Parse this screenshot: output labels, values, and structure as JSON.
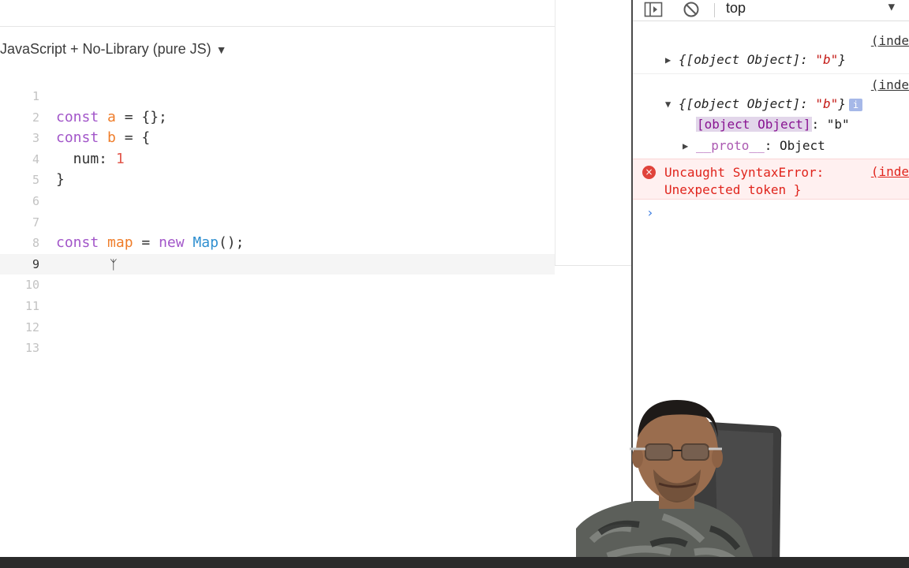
{
  "editor": {
    "language_selector": "JavaScript + No-Library (pure JS)",
    "active_line": 9,
    "lines": [
      {
        "n": "1",
        "tokens": []
      },
      {
        "n": "2",
        "tokens": [
          [
            "kw",
            "const"
          ],
          [
            "p",
            " "
          ],
          [
            "var",
            "a"
          ],
          [
            "p",
            " = {};"
          ]
        ]
      },
      {
        "n": "3",
        "tokens": [
          [
            "kw",
            "const"
          ],
          [
            "p",
            " "
          ],
          [
            "var",
            "b"
          ],
          [
            "p",
            " = {"
          ]
        ]
      },
      {
        "n": "4",
        "tokens": [
          [
            "p",
            "  num: "
          ],
          [
            "num",
            "1"
          ]
        ]
      },
      {
        "n": "5",
        "tokens": [
          [
            "p",
            "}"
          ]
        ]
      },
      {
        "n": "6",
        "tokens": []
      },
      {
        "n": "7",
        "tokens": []
      },
      {
        "n": "8",
        "tokens": [
          [
            "kw",
            "const"
          ],
          [
            "p",
            " "
          ],
          [
            "var",
            "map"
          ],
          [
            "p",
            " = "
          ],
          [
            "kw",
            "new"
          ],
          [
            "p",
            " "
          ],
          [
            "cls",
            "Map"
          ],
          [
            "p",
            "();"
          ]
        ]
      },
      {
        "n": "9",
        "tokens": []
      },
      {
        "n": "10",
        "tokens": []
      },
      {
        "n": "11",
        "tokens": []
      },
      {
        "n": "12",
        "tokens": []
      },
      {
        "n": "13",
        "tokens": []
      }
    ]
  },
  "console": {
    "context": "top",
    "source_link": "(inde",
    "msg1": {
      "key": "[object Object]",
      "value": "\"b\"",
      "open": "{",
      "sep": ": ",
      "close": "}"
    },
    "msg2": {
      "key": "[object Object]",
      "value": "\"b\"",
      "open": "{",
      "sep": ": ",
      "close": "}",
      "info": "i",
      "prop_key": "[object Object]",
      "prop_sep": ": ",
      "prop_value": "\"b\"",
      "proto_key": "__proto__",
      "proto_sep": ": ",
      "proto_value": "Object"
    },
    "error": {
      "line1": "Uncaught SyntaxError:",
      "line2": "Unexpected token }",
      "icon": "×"
    },
    "prompt": "›"
  },
  "colors": {
    "keyword": "#a256c9",
    "variable": "#ef7d2a",
    "class": "#2e8fd0",
    "number": "#e2574c",
    "error": "#e0241c"
  }
}
